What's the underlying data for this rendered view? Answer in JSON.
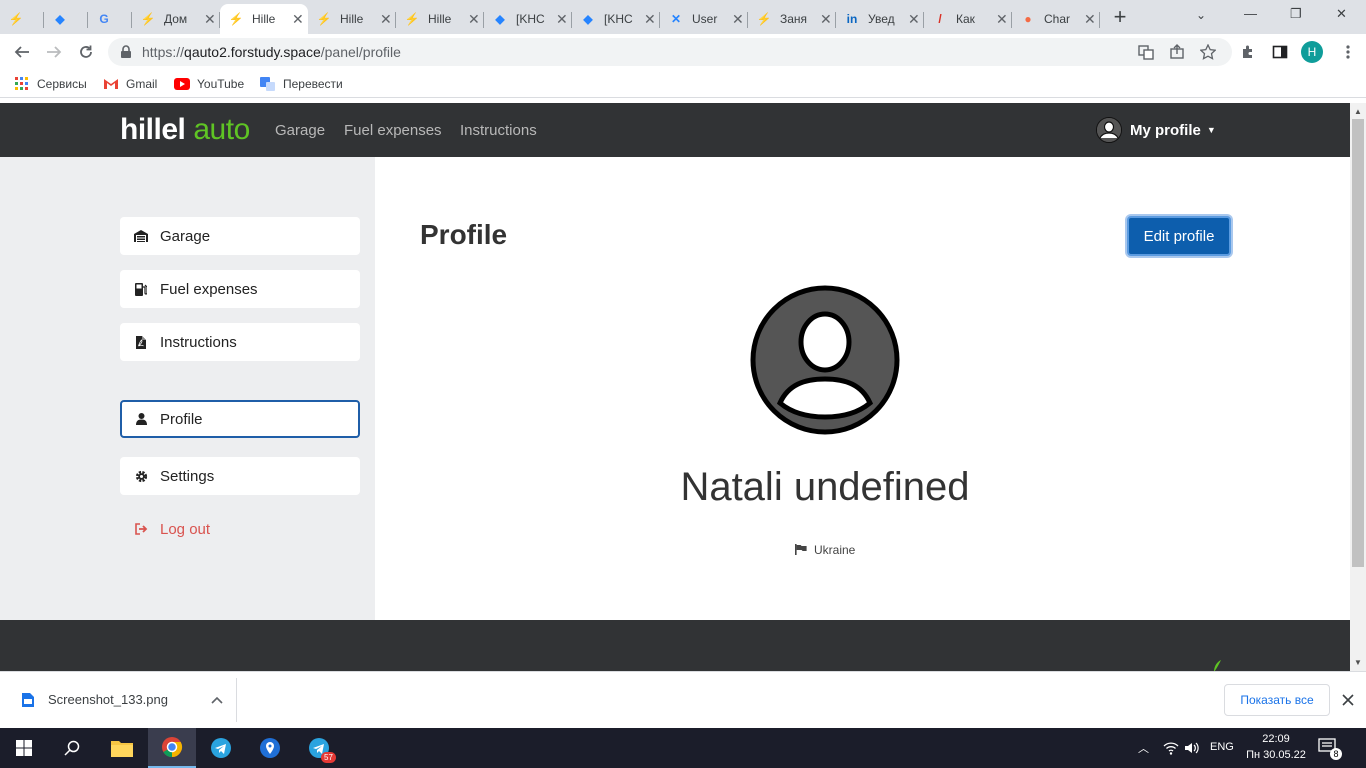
{
  "browser": {
    "tabs": [
      {
        "title": "",
        "icon": "hillel-icon",
        "active": false
      },
      {
        "title": "",
        "icon": "jira-icon",
        "active": false
      },
      {
        "title": "",
        "icon": "google-icon",
        "active": false
      },
      {
        "title": "Дом",
        "icon": "hillel-icon",
        "active": false
      },
      {
        "title": "Hille",
        "icon": "hillel-green-icon",
        "active": true
      },
      {
        "title": "Hille",
        "icon": "hillel-green-icon",
        "active": false
      },
      {
        "title": "Hille",
        "icon": "hillel-green-icon",
        "active": false
      },
      {
        "title": "[KHC",
        "icon": "jira-icon",
        "active": false
      },
      {
        "title": "[KHC",
        "icon": "jira-icon",
        "active": false
      },
      {
        "title": "User",
        "icon": "confluence-icon",
        "active": false
      },
      {
        "title": "Заня",
        "icon": "hillel-icon",
        "active": false
      },
      {
        "title": "Увед",
        "icon": "linkedin-icon",
        "active": false
      },
      {
        "title": "Как",
        "icon": "generic-icon",
        "active": false
      },
      {
        "title": "Char",
        "icon": "chart-icon",
        "active": false
      }
    ],
    "new_tab": "+",
    "url_host": "qauto2.forstudy.space",
    "url_scheme": "https://",
    "url_path": "/panel/profile",
    "profile_letter": "H",
    "bookmarks": [
      {
        "label": "Сервисы",
        "icon": "apps-grid-icon"
      },
      {
        "label": "Gmail",
        "icon": "gmail-icon"
      },
      {
        "label": "YouTube",
        "icon": "youtube-icon"
      },
      {
        "label": "Перевести",
        "icon": "translate-icon"
      }
    ]
  },
  "app": {
    "logo_main": "hillel",
    "logo_accent": "auto",
    "accent_color": "#5fc424",
    "nav": [
      "Garage",
      "Fuel expenses",
      "Instructions"
    ],
    "my_profile": "My profile",
    "sidebar": [
      {
        "label": "Garage",
        "icon": "garage-icon"
      },
      {
        "label": "Fuel expenses",
        "icon": "fuel-icon"
      },
      {
        "label": "Instructions",
        "icon": "document-icon"
      },
      {
        "label": "Profile",
        "icon": "user-icon"
      },
      {
        "label": "Settings",
        "icon": "gear-icon"
      },
      {
        "label": "Log out",
        "icon": "logout-icon"
      }
    ],
    "page_title": "Profile",
    "edit_button": "Edit profile",
    "user_name": "Natali undefined",
    "country": "Ukraine"
  },
  "downloads": {
    "file": "Screenshot_133.png",
    "show_all": "Показать все"
  },
  "taskbar": {
    "lang": "ENG",
    "time": "22:09",
    "date": "Пн 30.05.22",
    "notifications": "8",
    "telegram_badge": "57"
  }
}
